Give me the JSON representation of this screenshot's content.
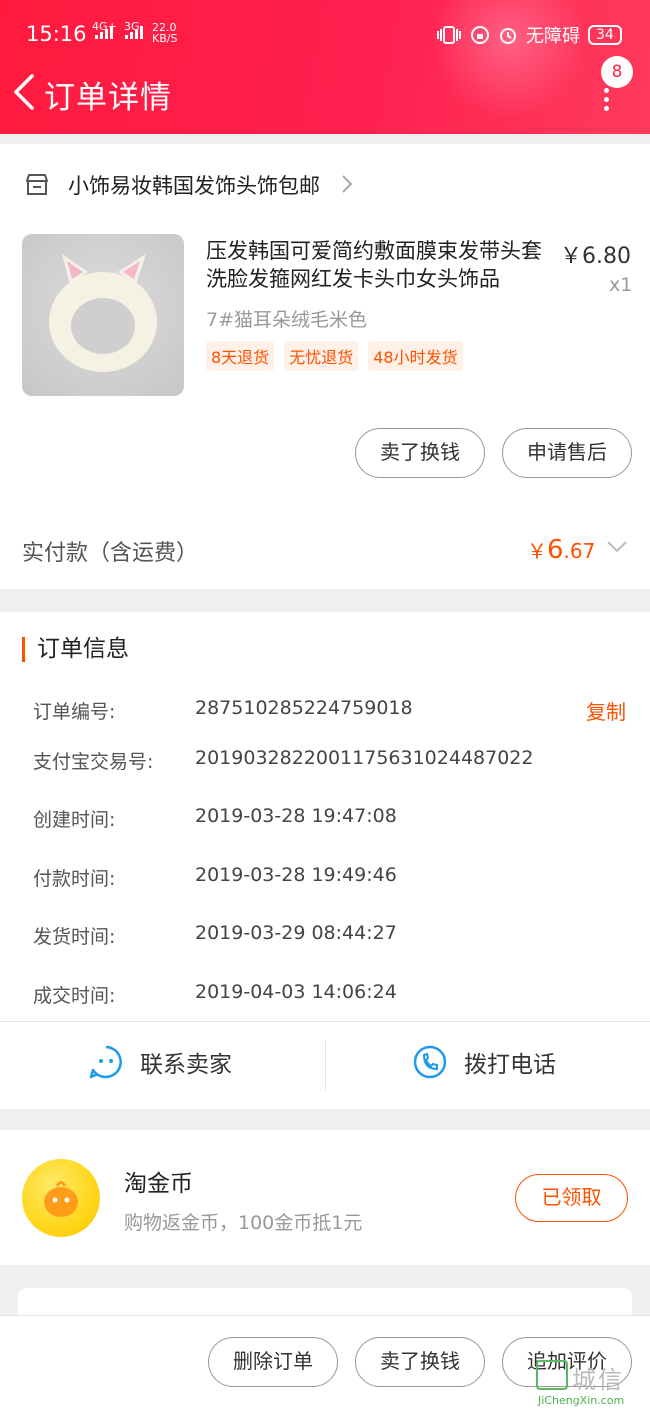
{
  "status_bar": {
    "time": "15:16",
    "net1": "4G+",
    "net2": "3G",
    "speed": "22.0\nKB/S",
    "accessibility": "无障碍",
    "battery": "34"
  },
  "header": {
    "title": "订单详情",
    "badge_count": "8",
    "background_color": "#ff2050"
  },
  "store": {
    "name": "小饰易妆韩国发饰头饰包邮",
    "icon": "store-icon"
  },
  "product": {
    "title": "压发韩国可爱简约敷面膜束发带头套洗脸发箍网红发卡头巾女头饰品",
    "price": "￥6.80",
    "quantity": "x1",
    "sku": "7#猫耳朵绒毛米色",
    "tags": [
      "8天退货",
      "无忧退货",
      "48小时发货"
    ]
  },
  "item_actions": {
    "sell_label": "卖了换钱",
    "after_sale_label": "申请售后"
  },
  "payment": {
    "label": "实付款（含运费）",
    "currency": "￥",
    "amount_int": "6",
    "amount_dec": ".67",
    "accent_color": "#ff5000"
  },
  "order_info": {
    "section_title": "订单信息",
    "copy_label": "复制",
    "rows": [
      {
        "label": "订单编号:",
        "value": "287510285224759018"
      },
      {
        "label": "支付宝交易号:",
        "value": "2019032822001175631024487022"
      },
      {
        "label": "创建时间:",
        "value": "2019-03-28 19:47:08"
      },
      {
        "label": "付款时间:",
        "value": "2019-03-28 19:49:46"
      },
      {
        "label": "发货时间:",
        "value": "2019-03-29 08:44:27"
      },
      {
        "label": "成交时间:",
        "value": "2019-04-03 14:06:24"
      }
    ]
  },
  "contact": {
    "seller_label": "联系卖家",
    "call_label": "拨打电话"
  },
  "coins": {
    "title": "淘金币",
    "desc": "购物返金币，100金币抵1元",
    "button": "已领取"
  },
  "bottom_bar": {
    "delete_label": "删除订单",
    "sell_label": "卖了换钱",
    "review_label": "追加评价"
  },
  "watermark": {
    "main": "城信",
    "sub": "JiChengXin.com"
  }
}
